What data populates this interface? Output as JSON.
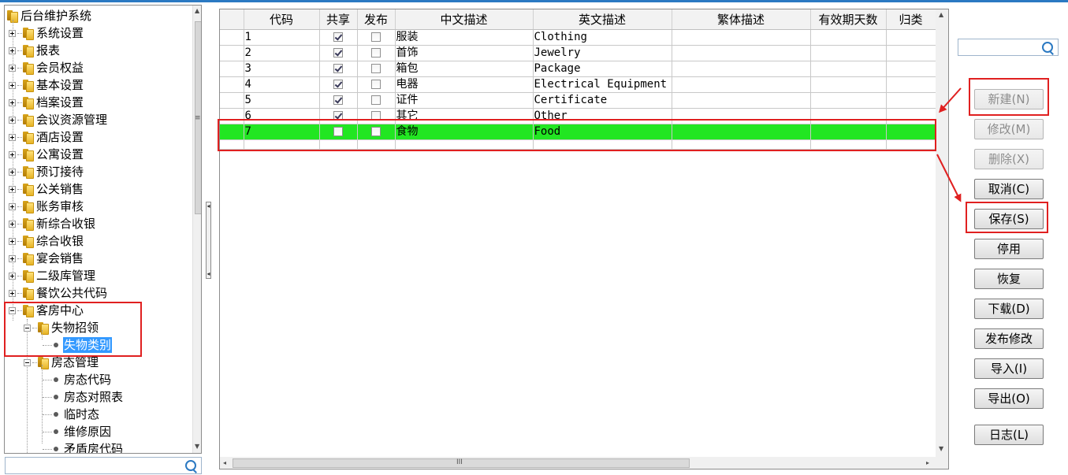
{
  "tree": {
    "root_label": "后台维护系统",
    "items": [
      {
        "label": "系统设置"
      },
      {
        "label": "报表"
      },
      {
        "label": "会员权益"
      },
      {
        "label": "基本设置"
      },
      {
        "label": "档案设置"
      },
      {
        "label": "会议资源管理"
      },
      {
        "label": "酒店设置"
      },
      {
        "label": "公寓设置"
      },
      {
        "label": "预订接待"
      },
      {
        "label": "公关销售"
      },
      {
        "label": "账务审核"
      },
      {
        "label": "新综合收银"
      },
      {
        "label": "综合收银"
      },
      {
        "label": "宴会销售"
      },
      {
        "label": "二级库管理"
      },
      {
        "label": "餐饮公共代码"
      }
    ],
    "expanded_group": {
      "label": "客房中心",
      "children": [
        {
          "label": "失物招领",
          "children": [
            {
              "label": "失物类别",
              "selected": true
            }
          ]
        },
        {
          "label": "房态管理",
          "children": [
            {
              "label": "房态代码"
            },
            {
              "label": "房态对照表"
            },
            {
              "label": "临时态"
            },
            {
              "label": "维修原因"
            },
            {
              "label": "矛盾房代码"
            }
          ]
        }
      ]
    }
  },
  "tree_search": {
    "value": ""
  },
  "top_search": {
    "value": ""
  },
  "grid": {
    "columns": [
      "",
      "代码",
      "共享",
      "发布",
      "中文描述",
      "英文描述",
      "繁体描述",
      "有效期天数",
      "归类"
    ],
    "rows": [
      {
        "code": "1",
        "shared": true,
        "published": false,
        "zh": "服装",
        "en": "Clothing",
        "tw": "",
        "days": "",
        "cat": ""
      },
      {
        "code": "2",
        "shared": true,
        "published": false,
        "zh": "首饰",
        "en": "Jewelry",
        "tw": "",
        "days": "",
        "cat": ""
      },
      {
        "code": "3",
        "shared": true,
        "published": false,
        "zh": "箱包",
        "en": "Package",
        "tw": "",
        "days": "",
        "cat": ""
      },
      {
        "code": "4",
        "shared": true,
        "published": false,
        "zh": "电器",
        "en": "Electrical Equipment",
        "tw": "",
        "days": "",
        "cat": ""
      },
      {
        "code": "5",
        "shared": true,
        "published": false,
        "zh": "证件",
        "en": "Certificate",
        "tw": "",
        "days": "",
        "cat": ""
      },
      {
        "code": "6",
        "shared": true,
        "published": false,
        "zh": "其它",
        "en": "Other",
        "tw": "",
        "days": "",
        "cat": ""
      },
      {
        "code": "7",
        "shared": false,
        "published": false,
        "zh": "食物",
        "en": "Food",
        "tw": "",
        "days": "",
        "cat": "",
        "selected": true
      }
    ]
  },
  "buttons": {
    "new": {
      "label": "新建(N)",
      "enabled": false
    },
    "edit": {
      "label": "修改(M)",
      "enabled": false
    },
    "delete": {
      "label": "删除(X)",
      "enabled": false
    },
    "cancel": {
      "label": "取消(C)",
      "enabled": true
    },
    "save": {
      "label": "保存(S)",
      "enabled": true
    },
    "disable": {
      "label": "停用",
      "enabled": true
    },
    "restore": {
      "label": "恢复",
      "enabled": true
    },
    "download": {
      "label": "下载(D)",
      "enabled": true
    },
    "publish_edit": {
      "label": "发布修改",
      "enabled": true
    },
    "import": {
      "label": "导入(I)",
      "enabled": true
    },
    "export": {
      "label": "导出(O)",
      "enabled": true
    },
    "log": {
      "label": "日志(L)",
      "enabled": true
    }
  },
  "colors": {
    "selected_row": "#22e622",
    "tree_selected": "#3399ff",
    "annotation": "#e02020",
    "accent": "#2b79c2"
  }
}
